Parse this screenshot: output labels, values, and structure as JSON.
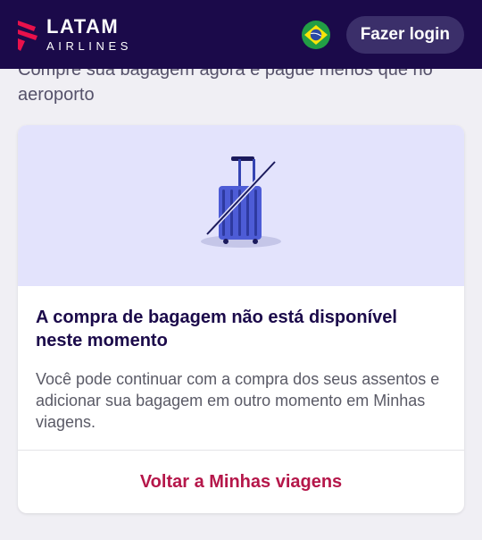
{
  "header": {
    "logo_primary": "LATAM",
    "logo_secondary": "AIRLINES",
    "country_flag": "brazil-flag-icon",
    "login_label": "Fazer login",
    "background_color": "#1b0a4a"
  },
  "intro_text": "Compre sua bagagem agora e pague menos que no aeroporto",
  "card": {
    "illustration_icon": "luggage-unavailable-icon",
    "title": "A compra de bagagem não está disponível neste momento",
    "description": "Você pode continuar com a compra dos seus assentos e adicionar sua bagagem em outro momento em Minhas viagens.",
    "link_label": "Voltar a Minhas viagens",
    "link_color": "#b5174a"
  }
}
